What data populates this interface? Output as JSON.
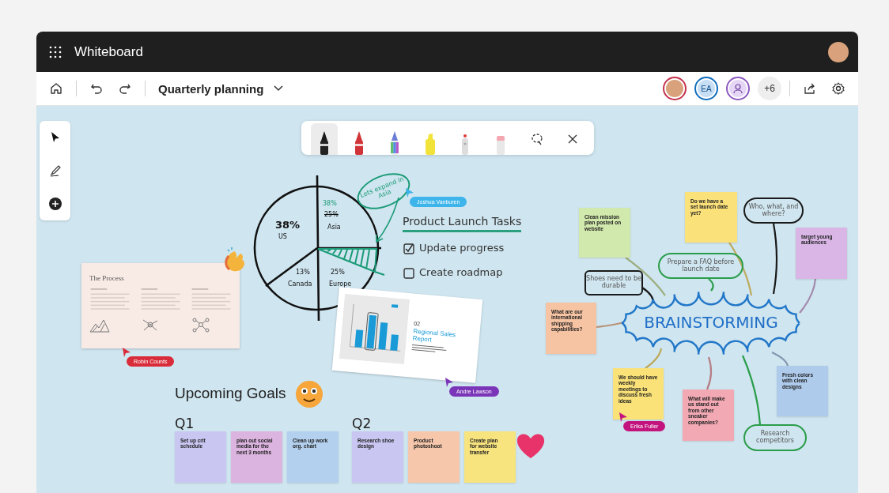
{
  "window": {
    "title": "Whiteboard"
  },
  "toolbar": {
    "board_title": "Quarterly planning",
    "more_count": "+6",
    "collaborators": [
      {
        "kind": "photo",
        "color": "#c4314b"
      },
      {
        "kind": "initials",
        "initials": "EA",
        "color": "#0f6cbd"
      },
      {
        "kind": "silhouette",
        "color": "#8a58c0"
      }
    ]
  },
  "pen_tray": {
    "pens": [
      {
        "kind": "pen",
        "color": "#1a1a1a",
        "selected": true
      },
      {
        "kind": "pen",
        "color": "#d13438",
        "selected": false
      },
      {
        "kind": "rainbow-pen",
        "color": "#6c7fd8",
        "selected": false
      },
      {
        "kind": "highlighter",
        "color": "#f2e33a",
        "selected": false
      },
      {
        "kind": "laser",
        "color": "#e03a3a",
        "selected": false
      },
      {
        "kind": "eraser",
        "color": "#f4a7b0",
        "selected": false
      }
    ]
  },
  "pie_sketch": {
    "segments": [
      {
        "value": "38%",
        "label": "US"
      },
      {
        "value": "38%",
        "struck_value": "25%",
        "label": "Asia"
      },
      {
        "value": "13%",
        "label": "Canada"
      },
      {
        "value": "25%",
        "label": "Europe"
      }
    ],
    "callout": "Lets expand in Asia"
  },
  "task_list": {
    "title": "Product Launch Tasks",
    "items": [
      {
        "text": "Update progress",
        "checked": true
      },
      {
        "text": "Create roadmap",
        "checked": false
      }
    ]
  },
  "process_slide": {
    "title": "The Process"
  },
  "sales_slide": {
    "number": "02",
    "title": "Regional Sales Report"
  },
  "cursors": [
    {
      "name": "Joshua Vanburen",
      "color": "#3db4ea"
    },
    {
      "name": "Robin Counts",
      "color": "#d92c3a"
    },
    {
      "name": "Andre Lawson",
      "color": "#7a35b8"
    },
    {
      "name": "Erika Fuller",
      "color": "#c3147e"
    }
  ],
  "goals": {
    "title": "Upcoming Goals",
    "columns": [
      {
        "label": "Q1",
        "notes": [
          {
            "text": "Set up crit schedule",
            "color": "#c9c6f2"
          },
          {
            "text": "plan out social media for the next 3 months",
            "color": "#dcb4e0"
          },
          {
            "text": "Clean up work org. chart",
            "color": "#b3d0ee"
          }
        ]
      },
      {
        "label": "Q2",
        "notes": [
          {
            "text": "Research shoe design",
            "color": "#c9c6f2"
          },
          {
            "text": "Product photoshoot",
            "color": "#f6c7ab"
          },
          {
            "text": "Create plan for website transfer",
            "color": "#f8e47e"
          }
        ]
      }
    ]
  },
  "mindmap": {
    "center": "BRAINSTORMING",
    "nodes": [
      {
        "kind": "sticky",
        "text": "Clean mission plan posted on website",
        "color": "#d2e9ad"
      },
      {
        "kind": "sticky",
        "text": "Do we have a set launch date yet?",
        "color": "#fbe179"
      },
      {
        "kind": "bubble",
        "text": "Who, what, and where?",
        "color": "#1a1a1a"
      },
      {
        "kind": "sticky",
        "text": "target young audiences",
        "color": "#d9b6e6"
      },
      {
        "kind": "bubble",
        "text": "Prepare a FAQ before launch date",
        "color": "#2a9d4a"
      },
      {
        "kind": "bubble",
        "text": "Shoes need to be durable",
        "color": "#1a1a1a"
      },
      {
        "kind": "sticky",
        "text": "What are our international shipping capabilities?",
        "color": "#f7c4a3"
      },
      {
        "kind": "sticky",
        "text": "We should have weekly meetings to discuss fresh ideas",
        "color": "#fae278"
      },
      {
        "kind": "sticky",
        "text": "What will make us stand out from other sneaker companies?",
        "color": "#f2a9b4"
      },
      {
        "kind": "sticky",
        "text": "Fresh colors with clean designs",
        "color": "#aecbec"
      },
      {
        "kind": "bubble",
        "text": "Research competitors",
        "color": "#2a9d4a"
      }
    ]
  }
}
